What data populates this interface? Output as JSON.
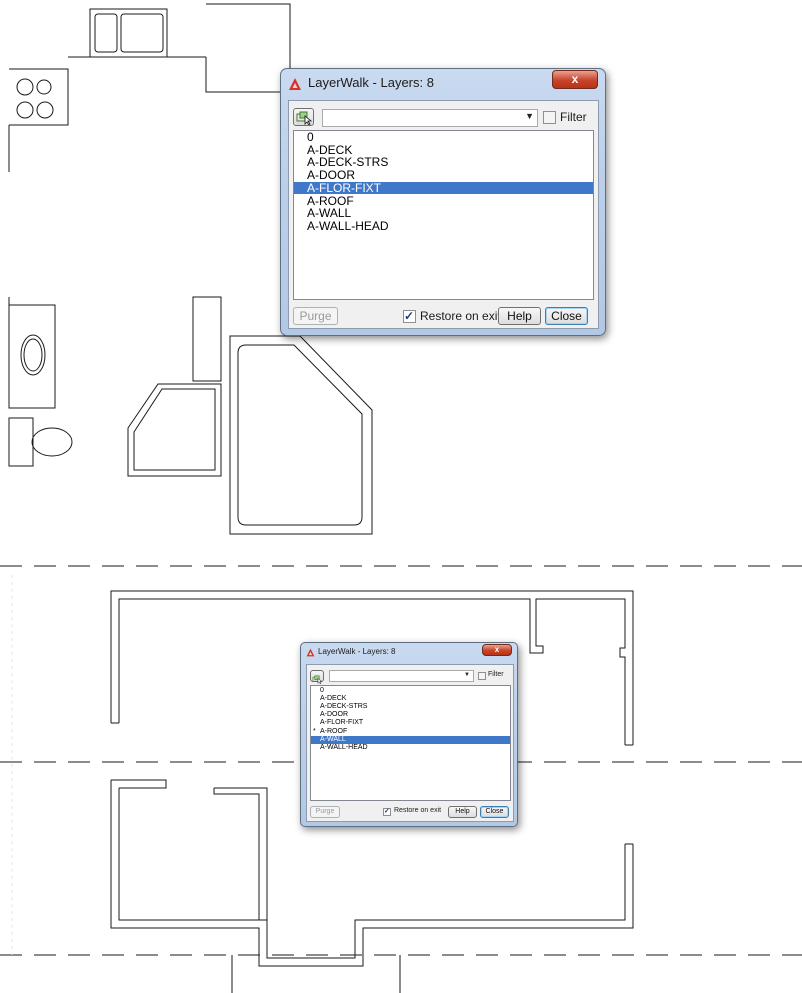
{
  "top_dialog": {
    "title": "LayerWalk - Layers: 8",
    "close_glyph": "x",
    "filter_label": "Filter",
    "filter_checked": false,
    "layers": [
      "0",
      "A-DECK",
      "A-DECK-STRS",
      "A-DOOR",
      "A-FLOR-FIXT",
      "A-ROOF",
      "A-WALL",
      "A-WALL-HEAD"
    ],
    "selected_index": 4,
    "purge_label": "Purge",
    "restore_label": "Restore on exit",
    "restore_checked": true,
    "help_label": "Help",
    "close_label": "Close"
  },
  "bottom_dialog": {
    "title": "LayerWalk - Layers: 8",
    "close_glyph": "x",
    "filter_label": "Filter",
    "filter_checked": false,
    "layers": [
      "0",
      "A-DECK",
      "A-DECK-STRS",
      "A-DOOR",
      "A-FLOR-FIXT",
      "A-ROOF",
      "A-WALL",
      "A-WALL-HEAD"
    ],
    "selected_index": 6,
    "marked_index": 5,
    "marker_glyph": "*",
    "purge_label": "Purge",
    "restore_label": "Restore on exit",
    "restore_checked": true,
    "help_label": "Help",
    "close_label": "Close"
  },
  "icons": {
    "app_icon": "autocad-logo-icon",
    "pick_button_icon": "select-objects-icon"
  },
  "colors": {
    "selection": "#3f78c8",
    "close_button": "#c8432a",
    "app_icon": "#d6322a"
  }
}
